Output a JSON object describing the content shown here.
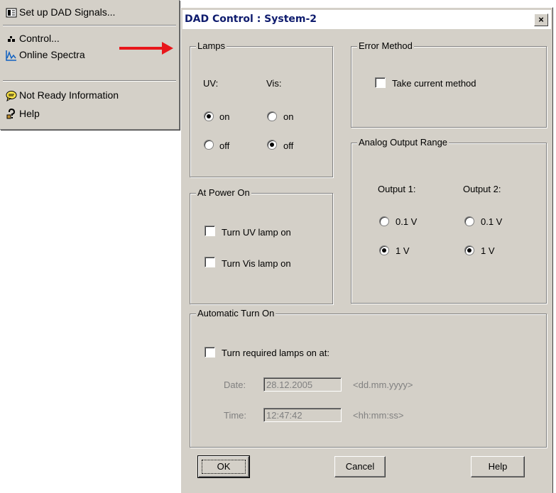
{
  "menu": {
    "items": [
      {
        "label": "Set up DAD Signals...",
        "icon": "signals-icon"
      },
      {
        "label": "Control...",
        "icon": "control-icon"
      },
      {
        "label": "Online Spectra",
        "icon": "spectra-icon"
      },
      {
        "label": "Not Ready Information",
        "icon": "info-bubble-icon"
      },
      {
        "label": "Help",
        "icon": "help-icon"
      }
    ]
  },
  "dialog": {
    "title": "DAD Control : System-2",
    "close_label": "×",
    "lamps": {
      "title": "Lamps",
      "uv_label": "UV:",
      "vis_label": "Vis:",
      "on_label": "on",
      "off_label": "off",
      "uv_selected": "on",
      "vis_selected": "off"
    },
    "error_method": {
      "title": "Error Method",
      "take_current_label": "Take current method",
      "take_current_checked": false
    },
    "analog_output": {
      "title": "Analog Output Range",
      "output1_label": "Output 1:",
      "output2_label": "Output 2:",
      "opt_01_label": "0.1 V",
      "opt_1_label": "1 V",
      "output1_selected": "1 V",
      "output2_selected": "1 V"
    },
    "power_on": {
      "title": "At Power On",
      "uv_label": "Turn UV lamp on",
      "vis_label": "Turn Vis lamp on",
      "uv_checked": false,
      "vis_checked": false
    },
    "auto_turn_on": {
      "title": "Automatic Turn On",
      "turn_required_label": "Turn required lamps on at:",
      "turn_required_checked": false,
      "date_label": "Date:",
      "date_value": "28.12.2005",
      "date_format": "<dd.mm.yyyy>",
      "time_label": "Time:",
      "time_value": "12:47:42",
      "time_format": "<hh:mm:ss>"
    },
    "buttons": {
      "ok": "OK",
      "cancel": "Cancel",
      "help": "Help"
    }
  },
  "colors": {
    "dialog_bg": "#d4d0c8",
    "title_text": "#0f1c6e",
    "arrow": "#e8161b"
  }
}
